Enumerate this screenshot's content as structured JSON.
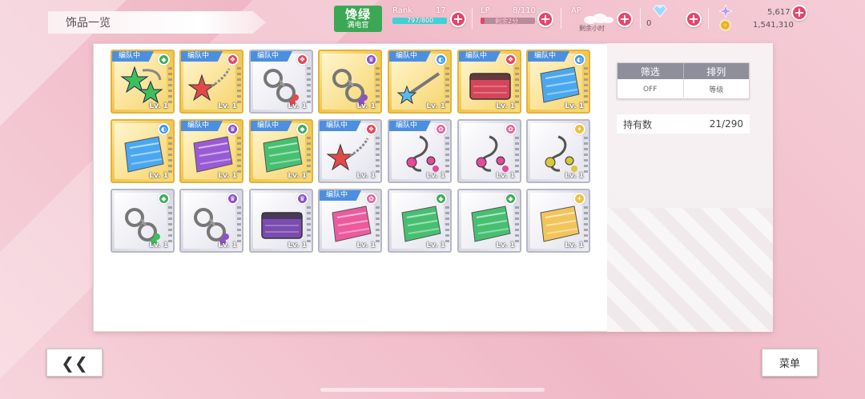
{
  "header": {
    "title": "饰品一览",
    "status_line1": "馋绿",
    "status_line2": "满电官",
    "rank_label": "Rank",
    "rank_value": "17",
    "rank_exp": "797/800",
    "rank_progress": 0.996,
    "lp_label": "LP",
    "lp_value": "8/110",
    "lp_recover": "剩余2分",
    "lp_progress": 0.07,
    "ap_label": "AP",
    "ap_recover": "剩余小时",
    "gems": "0",
    "coins_top": "5,617",
    "coins_bottom": "1,541,310"
  },
  "sidebar": {
    "filter_label": "筛选",
    "sort_label": "排列",
    "filter_value": "OFF",
    "sort_value": "等级",
    "owned_label": "持有数",
    "owned_value": "21/290"
  },
  "team_badge": "编队中",
  "attr_colors": {
    "green": "#3fae5a",
    "red": "#e24a5c",
    "purple": "#8b52c9",
    "blue": "#3d9be9",
    "pink": "#e667a6",
    "yellow": "#f0bf3d"
  },
  "items": [
    {
      "frame": "gold",
      "team": true,
      "attr": "green",
      "art": "stars-green",
      "lv": "Lv. 1"
    },
    {
      "frame": "gold",
      "team": true,
      "attr": "red",
      "art": "star-red",
      "lv": "Lv. 1"
    },
    {
      "frame": "silver",
      "team": true,
      "attr": "red",
      "art": "cuffs-red",
      "lv": "Lv. 1"
    },
    {
      "frame": "gold",
      "team": false,
      "attr": "purple",
      "art": "cuffs-purple",
      "lv": "Lv. 1"
    },
    {
      "frame": "gold",
      "team": true,
      "attr": "blue",
      "art": "wand-blue",
      "lv": "Lv. 1"
    },
    {
      "frame": "gold",
      "team": true,
      "attr": "red",
      "art": "pouch-red",
      "lv": "Lv. 1"
    },
    {
      "frame": "gold",
      "team": true,
      "attr": "blue",
      "art": "towel-blue",
      "lv": "Lv. 1"
    },
    {
      "frame": "gold",
      "team": false,
      "attr": "blue",
      "art": "towel-blue",
      "lv": "Lv. 1"
    },
    {
      "frame": "gold",
      "team": true,
      "attr": "purple",
      "art": "towel-purple",
      "lv": "Lv. 1"
    },
    {
      "frame": "gold",
      "team": true,
      "attr": "green",
      "art": "towel-green",
      "lv": "Lv. 1"
    },
    {
      "frame": "silver",
      "team": true,
      "attr": "red",
      "art": "star-red",
      "lv": "Lv. 1"
    },
    {
      "frame": "silver",
      "team": true,
      "attr": "pink",
      "art": "clef-pink",
      "lv": "Lv. 1"
    },
    {
      "frame": "silver",
      "team": false,
      "attr": "pink",
      "art": "clef-pink",
      "lv": "Lv. 1"
    },
    {
      "frame": "silver",
      "team": false,
      "attr": "yellow",
      "art": "clef-yellow",
      "lv": "Lv. 1"
    },
    {
      "frame": "silver",
      "team": false,
      "attr": "green",
      "art": "cuffs-green",
      "lv": "Lv. 1"
    },
    {
      "frame": "silver",
      "team": false,
      "attr": "purple",
      "art": "cuffs-purple",
      "lv": "Lv. 1"
    },
    {
      "frame": "silver",
      "team": false,
      "attr": "purple",
      "art": "pouch-purple",
      "lv": "Lv. 1"
    },
    {
      "frame": "silver",
      "team": true,
      "attr": "pink",
      "art": "towel-pink",
      "lv": "Lv. 1"
    },
    {
      "frame": "silver",
      "team": false,
      "attr": "green",
      "art": "towel-green",
      "lv": "Lv. 1"
    },
    {
      "frame": "silver",
      "team": false,
      "attr": "green",
      "art": "towel-green",
      "lv": "Lv. 1"
    },
    {
      "frame": "silver",
      "team": false,
      "attr": "yellow",
      "art": "towel-yellow",
      "lv": "Lv. 1"
    }
  ],
  "footer": {
    "back_label": "❮❮",
    "menu_label": "菜单"
  }
}
